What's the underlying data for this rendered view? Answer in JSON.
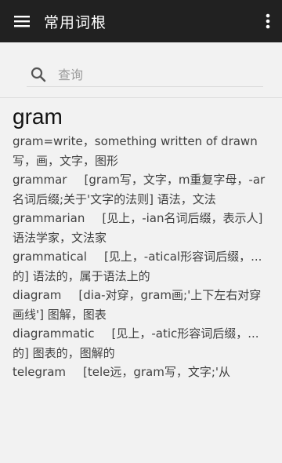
{
  "appbar": {
    "title": "常用词根",
    "menu_icon": "hamburger-menu-icon",
    "more_icon": "more-vertical-icon",
    "background": "#212121"
  },
  "search": {
    "placeholder": "查询",
    "icon": "search-icon"
  },
  "content": {
    "headword": "gram",
    "definition": "gram=write，something written of drawn 写，画，文字，图形",
    "entries": [
      {
        "word": "grammar",
        "meaning": "[gram写，文字，m重复字母，-ar名词后缀;关于'文字的法则] 语法，文法"
      },
      {
        "word": "grammarian",
        "meaning": "[见上，-ian名词后缀，表示人] 语法学家，文法家"
      },
      {
        "word": "grammatical",
        "meaning": "[见上，-atical形容词后缀，...的] 语法的，属于语法上的"
      },
      {
        "word": "diagram",
        "meaning": "[dia-对穿，gram画;'上下左右对穿画线'] 图解，图表"
      },
      {
        "word": "diagrammatic",
        "meaning": "[见上，-atic形容词后缀，...的] 图表的，图解的"
      },
      {
        "word": "telegram",
        "meaning": "[tele远，gram写，文字;'从"
      }
    ]
  }
}
